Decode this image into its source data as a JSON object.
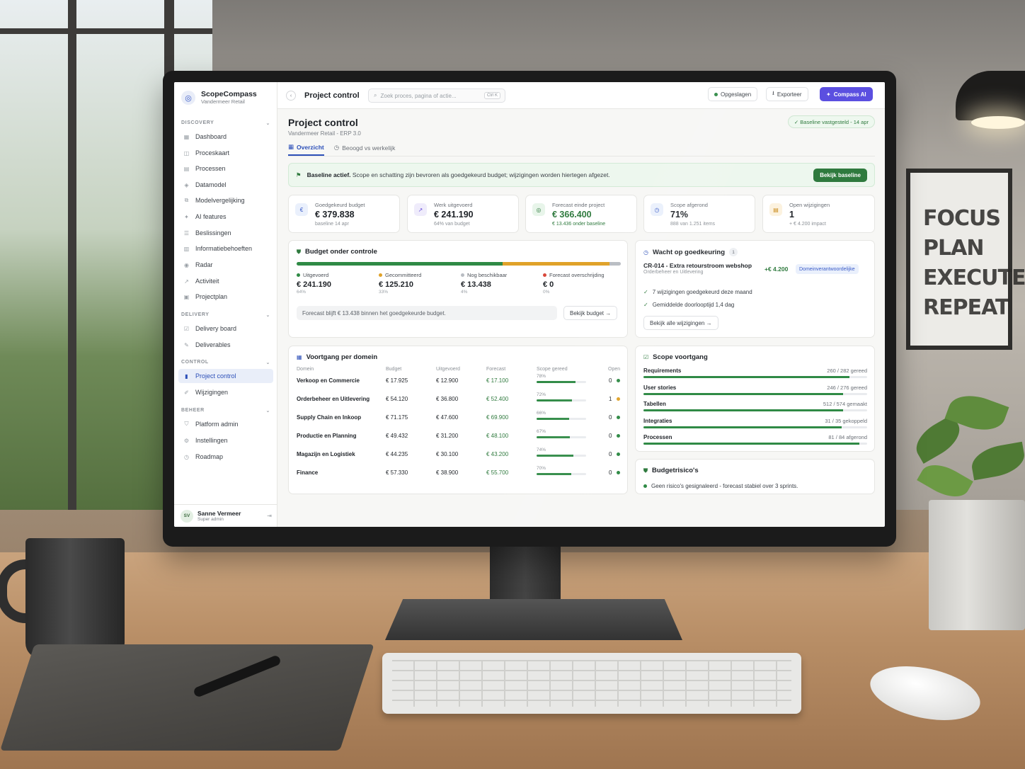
{
  "app": {
    "name": "ScopeCompass",
    "org": "Vandermeer Retail"
  },
  "sidebar": {
    "sections": [
      {
        "title": "DISCOVERY",
        "items": [
          {
            "label": "Dashboard",
            "icon": "grid-icon"
          },
          {
            "label": "Proceskaart",
            "icon": "map-icon"
          },
          {
            "label": "Processen",
            "icon": "list-icon"
          },
          {
            "label": "Datamodel",
            "icon": "database-icon"
          },
          {
            "label": "Modelvergelijking",
            "icon": "compare-icon"
          },
          {
            "label": "AI features",
            "icon": "sparkle-icon"
          },
          {
            "label": "Beslissingen",
            "icon": "decision-icon"
          },
          {
            "label": "Informatiebehoeften",
            "icon": "info-icon"
          },
          {
            "label": "Radar",
            "icon": "radar-icon"
          },
          {
            "label": "Activiteit",
            "icon": "activity-icon"
          },
          {
            "label": "Projectplan",
            "icon": "plan-icon"
          }
        ]
      },
      {
        "title": "DELIVERY",
        "items": [
          {
            "label": "Delivery board",
            "icon": "board-icon"
          },
          {
            "label": "Deliverables",
            "icon": "deliverable-icon"
          }
        ]
      },
      {
        "title": "CONTROL",
        "items": [
          {
            "label": "Project control",
            "icon": "control-icon",
            "active": true
          },
          {
            "label": "Wijzigingen",
            "icon": "edit-icon"
          }
        ]
      },
      {
        "title": "BEHEER",
        "items": [
          {
            "label": "Platform admin",
            "icon": "shield-icon"
          },
          {
            "label": "Instellingen",
            "icon": "gear-icon"
          },
          {
            "label": "Roadmap",
            "icon": "roadmap-icon"
          }
        ]
      }
    ],
    "user": {
      "initials": "SV",
      "name": "Sanne Vermeer",
      "role": "Super admin"
    }
  },
  "topbar": {
    "title": "Project control",
    "search_placeholder": "Zoek proces, pagina of actie...",
    "shortcut": "Ctrl K",
    "saved_label": "Opgeslagen",
    "export_label": "Exporteer",
    "ai_label": "Compass AI"
  },
  "page": {
    "title": "Project control",
    "subtitle": "Vandermeer Retail - ERP 3.0",
    "baseline_pill": "✓ Baseline vastgesteld - 14 apr",
    "tabs": [
      "Overzicht",
      "Beoogd vs werkelijk"
    ]
  },
  "banner": {
    "bold": "Baseline actief.",
    "text": "Scope en schatting zijn bevroren als goedgekeurd budget; wijzigingen worden hiertegen afgezet.",
    "button": "Bekijk baseline"
  },
  "kpis": [
    {
      "label": "Goedgekeurd budget",
      "value": "€ 379.838",
      "note": "baseline 14 apr",
      "icon": "€",
      "color": "#3a5bc7",
      "bg": "#eaf0fc"
    },
    {
      "label": "Werk uitgevoerd",
      "value": "€ 241.190",
      "note": "64% van budget",
      "icon": "↗",
      "color": "#6b4fd8",
      "bg": "#efecfb"
    },
    {
      "label": "Forecast einde project",
      "value": "€ 366.400",
      "note": "€ 13.436 onder baseline",
      "icon": "◎",
      "color": "#2f7a3e",
      "bg": "#e8f5ea",
      "green": true
    },
    {
      "label": "Scope afgerond",
      "value": "71%",
      "note": "888 van 1.251 items",
      "icon": "◷",
      "color": "#3a5bc7",
      "bg": "#eaf0fc"
    },
    {
      "label": "Open wijzigingen",
      "value": "1",
      "note": "+ € 4.200 impact",
      "icon": "▤",
      "color": "#c98a1a",
      "bg": "#fcf2df"
    }
  ],
  "budget": {
    "title": "Budget onder controle",
    "columns": [
      {
        "label": "Uitgevoerd",
        "value": "€ 241.190",
        "pct": "64%",
        "color": "#2f8a45",
        "share": 0.635
      },
      {
        "label": "Gecommitteerd",
        "value": "€ 125.210",
        "pct": "33%",
        "color": "#e0a229",
        "share": 0.33
      },
      {
        "label": "Nog beschikbaar",
        "value": "€ 13.438",
        "pct": "4%",
        "color": "#b8bcc2",
        "share": 0.035
      },
      {
        "label": "Forecast overschrijding",
        "value": "€ 0",
        "pct": "0%",
        "color": "#d9483b",
        "share": 0
      }
    ],
    "note": "Forecast blijft € 13.438 binnen het goedgekeurde budget.",
    "button": "Bekijk budget →"
  },
  "approval": {
    "title": "Wacht op goedkeuring",
    "count": "1",
    "cr_title": "CR-014 - Extra retourstroom webshop",
    "cr_sub": "Orderbeheer en Uitlevering",
    "cr_amount": "+€ 4.200",
    "cr_tag": "Domeinverantwoordelijke",
    "checks": [
      "7 wijzigingen goedgekeurd deze maand",
      "Gemiddelde doorlooptijd 1,4 dag"
    ],
    "button": "Bekijk alle wijzigingen →"
  },
  "domains": {
    "title": "Voortgang per domein",
    "headers": [
      "Domein",
      "Budget",
      "Uitgevoerd",
      "Forecast",
      "Scope gereed",
      "Open"
    ],
    "rows": [
      {
        "name": "Verkoop en Commercie",
        "budget": "€ 17.925",
        "done": "€ 12.900",
        "forecast": "€ 17.100",
        "scope": "78%",
        "scope_frac": 0.78,
        "open": "0",
        "status": "#2f8a45"
      },
      {
        "name": "Orderbeheer en Uitlevering",
        "budget": "€ 54.120",
        "done": "€ 36.800",
        "forecast": "€ 52.400",
        "scope": "72%",
        "scope_frac": 0.72,
        "open": "1",
        "status": "#e0a229"
      },
      {
        "name": "Supply Chain en Inkoop",
        "budget": "€ 71.175",
        "done": "€ 47.600",
        "forecast": "€ 69.900",
        "scope": "66%",
        "scope_frac": 0.66,
        "open": "0",
        "status": "#2f8a45"
      },
      {
        "name": "Productie en Planning",
        "budget": "€ 49.432",
        "done": "€ 31.200",
        "forecast": "€ 48.100",
        "scope": "67%",
        "scope_frac": 0.67,
        "open": "0",
        "status": "#2f8a45"
      },
      {
        "name": "Magazijn en Logistiek",
        "budget": "€ 44.235",
        "done": "€ 30.100",
        "forecast": "€ 43.200",
        "scope": "74%",
        "scope_frac": 0.74,
        "open": "0",
        "status": "#2f8a45"
      },
      {
        "name": "Finance",
        "budget": "€ 57.330",
        "done": "€ 38.900",
        "forecast": "€ 55.700",
        "scope": "70%",
        "scope_frac": 0.7,
        "open": "0",
        "status": "#2f8a45"
      }
    ]
  },
  "scope": {
    "title": "Scope voortgang",
    "rows": [
      {
        "label": "Requirements",
        "count": "260 / 282 gereed",
        "frac": 0.922
      },
      {
        "label": "User stories",
        "count": "246 / 276 gereed",
        "frac": 0.891
      },
      {
        "label": "Tabellen",
        "count": "512 / 574 gemaakt",
        "frac": 0.892
      },
      {
        "label": "Integraties",
        "count": "31 / 35 gekoppeld",
        "frac": 0.886
      },
      {
        "label": "Processen",
        "count": "81 / 84 afgerond",
        "frac": 0.964
      }
    ]
  },
  "risks": {
    "title": "Budgetrisico's",
    "text": "Geen risico's gesignaleerd - forecast stabiel over 3 sprints."
  },
  "poster": {
    "lines": [
      "FOCUS",
      "PLAN",
      "EXECUTE",
      "REPEAT"
    ]
  }
}
